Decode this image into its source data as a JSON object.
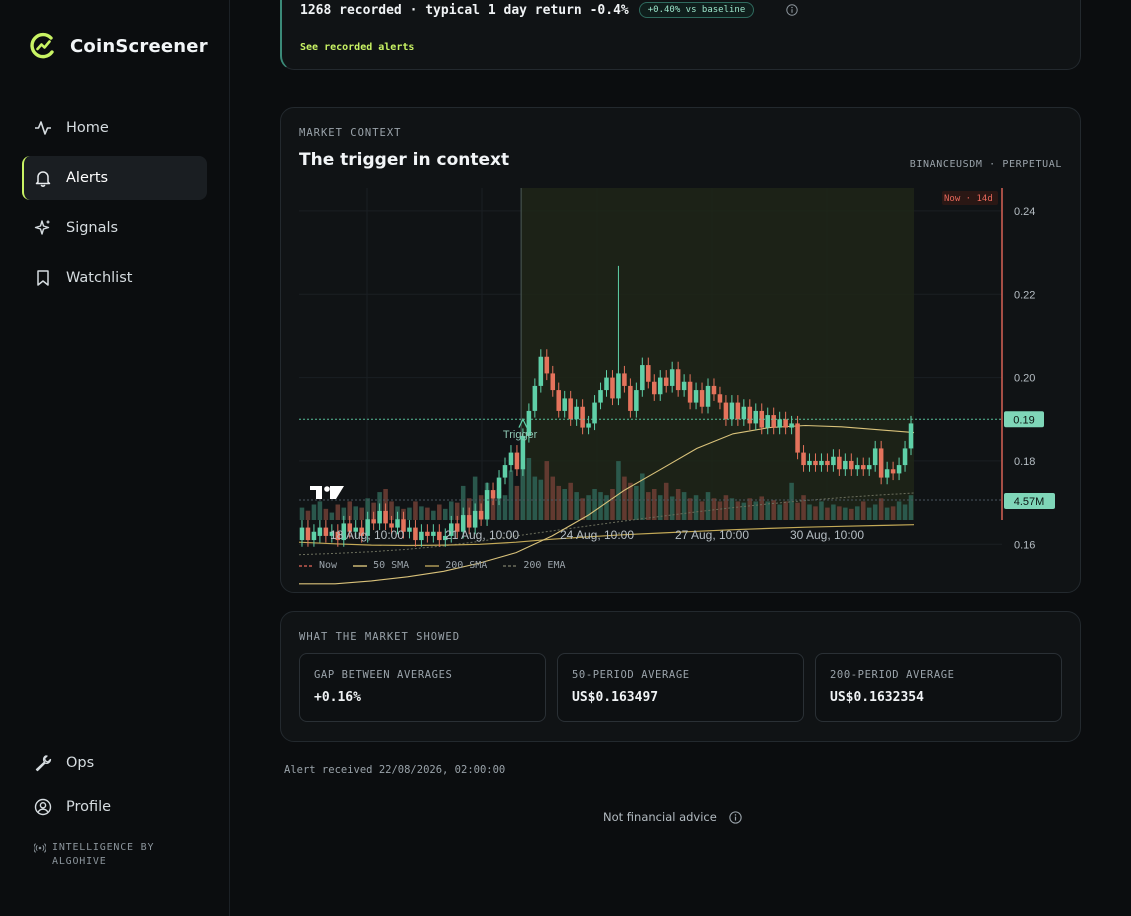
{
  "brand": {
    "name": "CoinScreener"
  },
  "nav": {
    "home": "Home",
    "alerts": "Alerts",
    "signals": "Signals",
    "watchlist": "Watchlist",
    "ops": "Ops",
    "profile": "Profile"
  },
  "powered_by": {
    "line1": "INTELLIGENCE BY",
    "line2": "ALGOHIVE"
  },
  "summary": {
    "stats": "1268 recorded · typical 1 day return -0.4%",
    "badge": "+0.40% vs baseline",
    "link": "See recorded alerts"
  },
  "market_context": {
    "eyebrow": "MARKET CONTEXT",
    "title": "The trigger in context",
    "exchange": "BINANCEUSDM · PERPETUAL",
    "now_tag": "Now · 14d",
    "trigger_label": "Trigger",
    "price_tag": "0.19",
    "volume_tag": "4.57M",
    "legend": {
      "now": "Now",
      "sma50": "50 SMA",
      "sma200": "200 SMA",
      "ema200": "200 EMA"
    }
  },
  "chart_data": {
    "type": "candlestick",
    "x_ticks": [
      "18 Aug, 10:00",
      "21 Aug, 10:00",
      "24 Aug, 10:00",
      "27 Aug, 10:00",
      "30 Aug, 10:00"
    ],
    "y_ticks": [
      "0.24",
      "0.22",
      "0.20",
      "0.18",
      "0.16"
    ],
    "ylim": [
      0.1555,
      0.2455
    ],
    "current_price": 0.19,
    "current_volume": "4.57M",
    "trigger_index": 37,
    "candles": [
      [
        0.161,
        0.164
      ],
      [
        0.164,
        0.161
      ],
      [
        0.161,
        0.163
      ],
      [
        0.162,
        0.164
      ],
      [
        0.164,
        0.162
      ],
      [
        0.162,
        0.163
      ],
      [
        0.163,
        0.161
      ],
      [
        0.161,
        0.165
      ],
      [
        0.165,
        0.163
      ],
      [
        0.163,
        0.164
      ],
      [
        0.164,
        0.162
      ],
      [
        0.162,
        0.166
      ],
      [
        0.166,
        0.165
      ],
      [
        0.165,
        0.168
      ],
      [
        0.168,
        0.165
      ],
      [
        0.165,
        0.164
      ],
      [
        0.164,
        0.166
      ],
      [
        0.166,
        0.163
      ],
      [
        0.163,
        0.164
      ],
      [
        0.164,
        0.161
      ],
      [
        0.161,
        0.163
      ],
      [
        0.163,
        0.162
      ],
      [
        0.162,
        0.163
      ],
      [
        0.163,
        0.161
      ],
      [
        0.161,
        0.162
      ],
      [
        0.162,
        0.165
      ],
      [
        0.165,
        0.163
      ],
      [
        0.163,
        0.167
      ],
      [
        0.167,
        0.164
      ],
      [
        0.164,
        0.168
      ],
      [
        0.168,
        0.166
      ],
      [
        0.166,
        0.173
      ],
      [
        0.173,
        0.171
      ],
      [
        0.171,
        0.176
      ],
      [
        0.176,
        0.179
      ],
      [
        0.179,
        0.182
      ],
      [
        0.182,
        0.178
      ],
      [
        0.178,
        0.186
      ],
      [
        0.186,
        0.192
      ],
      [
        0.192,
        0.198
      ],
      [
        0.198,
        0.205
      ],
      [
        0.205,
        0.201
      ],
      [
        0.201,
        0.197
      ],
      [
        0.197,
        0.192
      ],
      [
        0.192,
        0.195
      ],
      [
        0.195,
        0.19
      ],
      [
        0.19,
        0.193
      ],
      [
        0.193,
        0.188
      ],
      [
        0.188,
        0.189
      ],
      [
        0.189,
        0.194
      ],
      [
        0.194,
        0.197
      ],
      [
        0.197,
        0.2
      ],
      [
        0.2,
        0.195
      ],
      [
        0.195,
        0.201
      ],
      [
        0.201,
        0.198
      ],
      [
        0.198,
        0.192
      ],
      [
        0.192,
        0.197
      ],
      [
        0.197,
        0.203
      ],
      [
        0.203,
        0.199
      ],
      [
        0.199,
        0.196
      ],
      [
        0.196,
        0.2
      ],
      [
        0.2,
        0.198
      ],
      [
        0.198,
        0.202
      ],
      [
        0.202,
        0.197
      ],
      [
        0.197,
        0.199
      ],
      [
        0.199,
        0.194
      ],
      [
        0.194,
        0.197
      ],
      [
        0.197,
        0.193
      ],
      [
        0.193,
        0.198
      ],
      [
        0.198,
        0.196
      ],
      [
        0.196,
        0.194
      ],
      [
        0.194,
        0.19
      ],
      [
        0.19,
        0.194
      ],
      [
        0.194,
        0.19
      ],
      [
        0.19,
        0.193
      ],
      [
        0.193,
        0.189
      ],
      [
        0.189,
        0.192
      ],
      [
        0.192,
        0.188
      ],
      [
        0.188,
        0.191
      ],
      [
        0.191,
        0.188
      ],
      [
        0.188,
        0.19
      ],
      [
        0.19,
        0.188
      ],
      [
        0.188,
        0.189
      ],
      [
        0.189,
        0.182
      ],
      [
        0.182,
        0.179
      ],
      [
        0.179,
        0.18
      ],
      [
        0.18,
        0.179
      ],
      [
        0.179,
        0.18
      ],
      [
        0.18,
        0.179
      ],
      [
        0.179,
        0.181
      ],
      [
        0.181,
        0.178
      ],
      [
        0.178,
        0.18
      ],
      [
        0.18,
        0.178
      ],
      [
        0.178,
        0.179
      ],
      [
        0.179,
        0.178
      ],
      [
        0.178,
        0.179
      ],
      [
        0.179,
        0.183
      ],
      [
        0.183,
        0.176
      ],
      [
        0.176,
        0.178
      ],
      [
        0.178,
        0.177
      ],
      [
        0.177,
        0.179
      ],
      [
        0.179,
        0.183
      ],
      [
        0.183,
        0.189
      ]
    ],
    "volume_relative": [
      0.2,
      0.15,
      0.25,
      0.3,
      0.18,
      0.12,
      0.25,
      0.2,
      0.3,
      0.22,
      0.2,
      0.35,
      0.28,
      0.45,
      0.5,
      0.3,
      0.22,
      0.18,
      0.2,
      0.3,
      0.22,
      0.2,
      0.15,
      0.25,
      0.18,
      0.3,
      0.28,
      0.55,
      0.35,
      0.7,
      0.4,
      0.6,
      0.35,
      0.5,
      0.4,
      0.8,
      0.55,
      0.9,
      1.0,
      0.7,
      0.65,
      0.95,
      0.7,
      0.55,
      0.5,
      0.6,
      0.45,
      0.35,
      0.4,
      0.5,
      0.45,
      0.4,
      0.5,
      0.95,
      0.7,
      0.6,
      0.55,
      0.75,
      0.45,
      0.5,
      0.4,
      0.6,
      0.38,
      0.5,
      0.45,
      0.35,
      0.4,
      0.3,
      0.45,
      0.35,
      0.3,
      0.4,
      0.35,
      0.3,
      0.28,
      0.35,
      0.3,
      0.38,
      0.3,
      0.32,
      0.25,
      0.3,
      0.6,
      0.28,
      0.4,
      0.25,
      0.22,
      0.3,
      0.2,
      0.25,
      0.22,
      0.2,
      0.18,
      0.22,
      0.3,
      0.2,
      0.25,
      0.35,
      0.2,
      0.22,
      0.3,
      0.25,
      0.4
    ],
    "series_lines": {
      "sma50": [
        0.1505,
        0.1505,
        0.1512,
        0.1522,
        0.1535,
        0.1555,
        0.158,
        0.162,
        0.167,
        0.173,
        0.178,
        0.183,
        0.1865,
        0.188,
        0.1885,
        0.1882,
        0.1875,
        0.1868
      ],
      "sma200": [
        0.1605,
        0.1601,
        0.1598,
        0.1597,
        0.1598,
        0.16,
        0.1605,
        0.1612,
        0.1618,
        0.1623,
        0.1627,
        0.1631,
        0.1635,
        0.1638,
        0.1641,
        0.1643,
        0.1645,
        0.1647
      ],
      "ema200": [
        0.1575,
        0.1578,
        0.1582,
        0.1588,
        0.1596,
        0.1607,
        0.162,
        0.1632,
        0.1644,
        0.1656,
        0.1667,
        0.1678,
        0.1688,
        0.1697,
        0.1705,
        0.1712,
        0.1718,
        0.1723
      ]
    }
  },
  "what_market_showed": {
    "eyebrow": "WHAT THE MARKET SHOWED",
    "cards": [
      {
        "label": "GAP BETWEEN AVERAGES",
        "value": "+0.16%"
      },
      {
        "label": "50-PERIOD AVERAGE",
        "value": "US$0.163497"
      },
      {
        "label": "200-PERIOD AVERAGE",
        "value": "US$0.1632354"
      }
    ]
  },
  "footer": {
    "alert_received": "Alert received 22/08/2026, 02:00:00",
    "disclaimer": "Not financial advice"
  },
  "colors": {
    "accent": "#c9f364",
    "up": "#5fd0a8",
    "down": "#e4735c",
    "sma50": "#d9c27a",
    "now_line": "#e5675a"
  }
}
